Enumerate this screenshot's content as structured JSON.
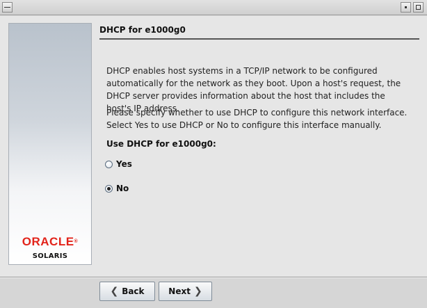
{
  "window": {
    "title": "",
    "controls": {
      "menu_icon": "window-menu-icon",
      "minimize_icon": "minimize-icon",
      "maximize_icon": "maximize-icon"
    }
  },
  "sidebar": {
    "logo_text": "ORACLE",
    "logo_mark": "®",
    "product": "SOLARIS",
    "brand_color": "#e2231a"
  },
  "panel": {
    "title": "DHCP for e1000g0",
    "paragraphs": [
      "DHCP enables host systems in a TCP/IP network to be configured automatically for the network as they boot. Upon a host's request, the DHCP server provides information about the host that includes the host's IP address.",
      "Please specify whether to use DHCP to configure this network interface. Select Yes to use DHCP or No to configure this interface manually."
    ],
    "question": "Use DHCP for e1000g0:",
    "options": [
      {
        "label": "Yes",
        "selected": false
      },
      {
        "label": "No",
        "selected": true
      }
    ]
  },
  "buttons": {
    "back_label": "Back",
    "next_label": "Next",
    "back_icon": "chevron-left-icon",
    "next_icon": "chevron-right-icon"
  }
}
